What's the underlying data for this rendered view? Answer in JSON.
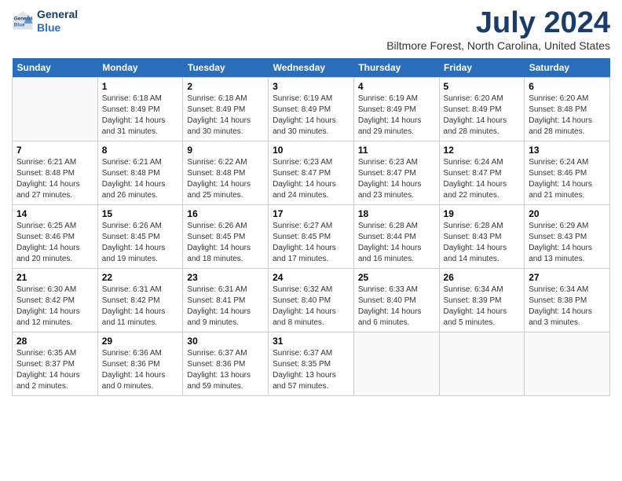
{
  "logo": {
    "line1": "General",
    "line2": "Blue"
  },
  "title": "July 2024",
  "location": "Biltmore Forest, North Carolina, United States",
  "days_of_week": [
    "Sunday",
    "Monday",
    "Tuesday",
    "Wednesday",
    "Thursday",
    "Friday",
    "Saturday"
  ],
  "weeks": [
    [
      {
        "day": "",
        "content": ""
      },
      {
        "day": "1",
        "content": "Sunrise: 6:18 AM\nSunset: 8:49 PM\nDaylight: 14 hours\nand 31 minutes."
      },
      {
        "day": "2",
        "content": "Sunrise: 6:18 AM\nSunset: 8:49 PM\nDaylight: 14 hours\nand 30 minutes."
      },
      {
        "day": "3",
        "content": "Sunrise: 6:19 AM\nSunset: 8:49 PM\nDaylight: 14 hours\nand 30 minutes."
      },
      {
        "day": "4",
        "content": "Sunrise: 6:19 AM\nSunset: 8:49 PM\nDaylight: 14 hours\nand 29 minutes."
      },
      {
        "day": "5",
        "content": "Sunrise: 6:20 AM\nSunset: 8:49 PM\nDaylight: 14 hours\nand 28 minutes."
      },
      {
        "day": "6",
        "content": "Sunrise: 6:20 AM\nSunset: 8:48 PM\nDaylight: 14 hours\nand 28 minutes."
      }
    ],
    [
      {
        "day": "7",
        "content": "Sunrise: 6:21 AM\nSunset: 8:48 PM\nDaylight: 14 hours\nand 27 minutes."
      },
      {
        "day": "8",
        "content": "Sunrise: 6:21 AM\nSunset: 8:48 PM\nDaylight: 14 hours\nand 26 minutes."
      },
      {
        "day": "9",
        "content": "Sunrise: 6:22 AM\nSunset: 8:48 PM\nDaylight: 14 hours\nand 25 minutes."
      },
      {
        "day": "10",
        "content": "Sunrise: 6:23 AM\nSunset: 8:47 PM\nDaylight: 14 hours\nand 24 minutes."
      },
      {
        "day": "11",
        "content": "Sunrise: 6:23 AM\nSunset: 8:47 PM\nDaylight: 14 hours\nand 23 minutes."
      },
      {
        "day": "12",
        "content": "Sunrise: 6:24 AM\nSunset: 8:47 PM\nDaylight: 14 hours\nand 22 minutes."
      },
      {
        "day": "13",
        "content": "Sunrise: 6:24 AM\nSunset: 8:46 PM\nDaylight: 14 hours\nand 21 minutes."
      }
    ],
    [
      {
        "day": "14",
        "content": "Sunrise: 6:25 AM\nSunset: 8:46 PM\nDaylight: 14 hours\nand 20 minutes."
      },
      {
        "day": "15",
        "content": "Sunrise: 6:26 AM\nSunset: 8:45 PM\nDaylight: 14 hours\nand 19 minutes."
      },
      {
        "day": "16",
        "content": "Sunrise: 6:26 AM\nSunset: 8:45 PM\nDaylight: 14 hours\nand 18 minutes."
      },
      {
        "day": "17",
        "content": "Sunrise: 6:27 AM\nSunset: 8:45 PM\nDaylight: 14 hours\nand 17 minutes."
      },
      {
        "day": "18",
        "content": "Sunrise: 6:28 AM\nSunset: 8:44 PM\nDaylight: 14 hours\nand 16 minutes."
      },
      {
        "day": "19",
        "content": "Sunrise: 6:28 AM\nSunset: 8:43 PM\nDaylight: 14 hours\nand 14 minutes."
      },
      {
        "day": "20",
        "content": "Sunrise: 6:29 AM\nSunset: 8:43 PM\nDaylight: 14 hours\nand 13 minutes."
      }
    ],
    [
      {
        "day": "21",
        "content": "Sunrise: 6:30 AM\nSunset: 8:42 PM\nDaylight: 14 hours\nand 12 minutes."
      },
      {
        "day": "22",
        "content": "Sunrise: 6:31 AM\nSunset: 8:42 PM\nDaylight: 14 hours\nand 11 minutes."
      },
      {
        "day": "23",
        "content": "Sunrise: 6:31 AM\nSunset: 8:41 PM\nDaylight: 14 hours\nand 9 minutes."
      },
      {
        "day": "24",
        "content": "Sunrise: 6:32 AM\nSunset: 8:40 PM\nDaylight: 14 hours\nand 8 minutes."
      },
      {
        "day": "25",
        "content": "Sunrise: 6:33 AM\nSunset: 8:40 PM\nDaylight: 14 hours\nand 6 minutes."
      },
      {
        "day": "26",
        "content": "Sunrise: 6:34 AM\nSunset: 8:39 PM\nDaylight: 14 hours\nand 5 minutes."
      },
      {
        "day": "27",
        "content": "Sunrise: 6:34 AM\nSunset: 8:38 PM\nDaylight: 14 hours\nand 3 minutes."
      }
    ],
    [
      {
        "day": "28",
        "content": "Sunrise: 6:35 AM\nSunset: 8:37 PM\nDaylight: 14 hours\nand 2 minutes."
      },
      {
        "day": "29",
        "content": "Sunrise: 6:36 AM\nSunset: 8:36 PM\nDaylight: 14 hours\nand 0 minutes."
      },
      {
        "day": "30",
        "content": "Sunrise: 6:37 AM\nSunset: 8:36 PM\nDaylight: 13 hours\nand 59 minutes."
      },
      {
        "day": "31",
        "content": "Sunrise: 6:37 AM\nSunset: 8:35 PM\nDaylight: 13 hours\nand 57 minutes."
      },
      {
        "day": "",
        "content": ""
      },
      {
        "day": "",
        "content": ""
      },
      {
        "day": "",
        "content": ""
      }
    ]
  ]
}
